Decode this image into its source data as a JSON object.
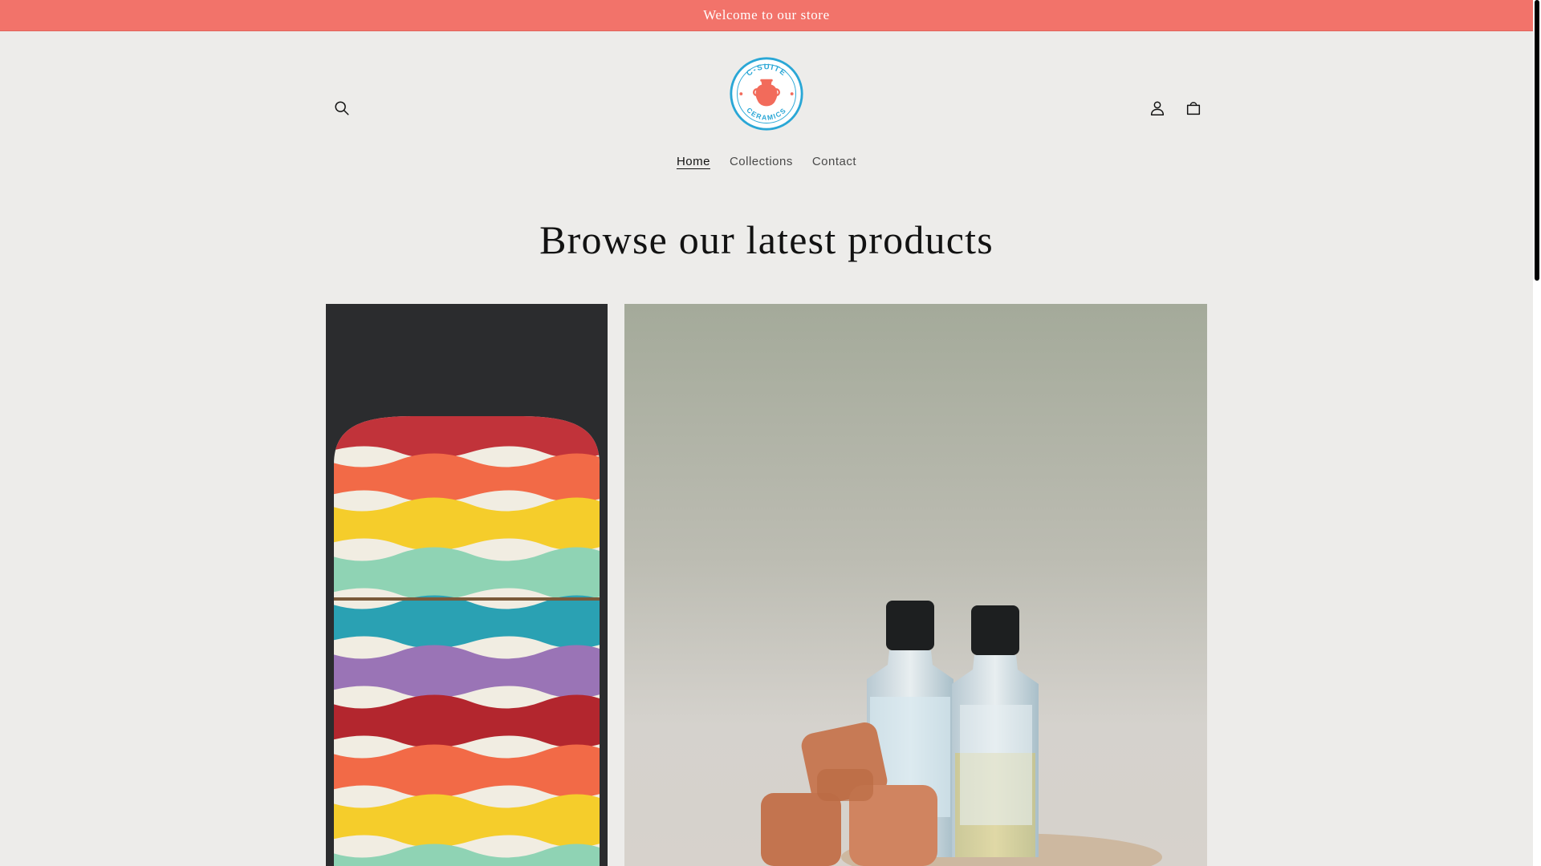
{
  "announcement": {
    "text": "Welcome to our store"
  },
  "header": {
    "logo": {
      "alt": "C-Suite Ceramics",
      "ring_text": "C-SUITE · CERAMICS ·",
      "colors": {
        "primary": "#2aa7d6",
        "accent": "#f26b5b"
      }
    },
    "search_icon": "search-icon",
    "account_icon": "account-icon",
    "cart_icon": "cart-icon"
  },
  "nav": {
    "items": [
      {
        "label": "Home",
        "active": true
      },
      {
        "label": "Collections",
        "active": false
      },
      {
        "label": "Contact",
        "active": false
      }
    ]
  },
  "main": {
    "headline": "Browse our latest products",
    "products": [
      {
        "image": "striped-ceramic-vase"
      },
      {
        "image": "essential-oil-bottles-with-clay-cubes"
      }
    ]
  },
  "theme": {
    "background": "#edecea",
    "announcement_bg": "#f2736a",
    "text": "#121212"
  }
}
